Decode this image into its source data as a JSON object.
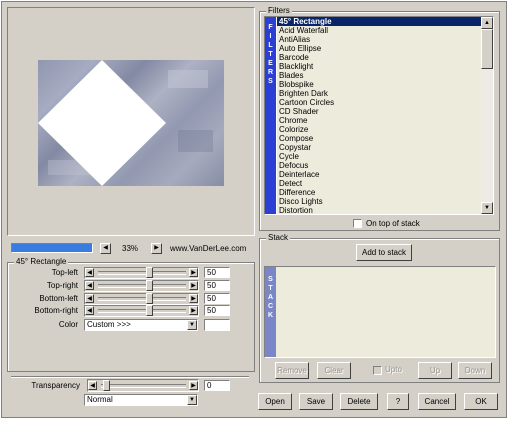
{
  "filters": {
    "label": "Filters",
    "band": "FILTERS",
    "items": [
      "45° Rectangle",
      "Acid Waterfall",
      "AntiAlias",
      "Auto Ellipse",
      "Barcode",
      "Blacklight",
      "Blades",
      "Blobspike",
      "Brighten Dark",
      "Cartoon Circles",
      "CD Shader",
      "Chrome",
      "Colorize",
      "Compose",
      "Copystar",
      "Cycle",
      "Defocus",
      "Deinterlace",
      "Detect",
      "Difference",
      "Disco Lights",
      "Distortion"
    ],
    "selected_index": 0,
    "on_top_label": "On top of stack"
  },
  "preview": {
    "zoom_value": "33%",
    "website": "www.VanDerLee.com",
    "progress": 1.0
  },
  "params": {
    "label": "45° Rectangle",
    "rows": [
      {
        "label": "Top-left",
        "value": "50"
      },
      {
        "label": "Top-right",
        "value": "50"
      },
      {
        "label": "Bottom-left",
        "value": "50"
      },
      {
        "label": "Bottom-right",
        "value": "50"
      }
    ],
    "color_label": "Color",
    "color_value": "Custom >>>"
  },
  "transparency": {
    "label": "Transparency",
    "value": "0",
    "blend_mode": "Normal"
  },
  "stack": {
    "label": "Stack",
    "band": "STACK",
    "add_label": "Add to stack",
    "remove_label": "Remove",
    "clear_label": "Clear",
    "upto_label": "Upto",
    "up_label": "Up",
    "down_label": "Down"
  },
  "buttons": {
    "open": "Open",
    "save": "Save",
    "delete": "Delete",
    "help": "?",
    "cancel": "Cancel",
    "ok": "OK"
  }
}
